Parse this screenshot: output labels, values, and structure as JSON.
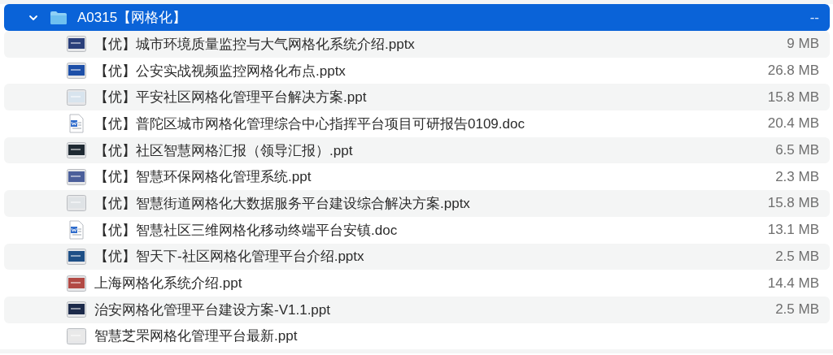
{
  "folder": {
    "name": "A0315【网格化】",
    "size": "--",
    "expanded": true,
    "selected": true
  },
  "files": [
    {
      "name": "【优】城市环境质量监控与大气网格化系统介绍.pptx",
      "size": "9 MB",
      "kind": "slide",
      "color": "#2a3f7a"
    },
    {
      "name": "【优】公安实战视频监控网格化布点.pptx",
      "size": "26.8 MB",
      "kind": "slide",
      "color": "#1d4fa8"
    },
    {
      "name": "【优】平安社区网格化管理平台解决方案.ppt",
      "size": "15.8 MB",
      "kind": "slide",
      "color": "#d8e4ee"
    },
    {
      "name": "【优】普陀区城市网格化管理综合中心指挥平台项目可研报告0109.doc",
      "size": "20.4 MB",
      "kind": "word"
    },
    {
      "name": "【优】社区智慧网格汇报（领导汇报）.ppt",
      "size": "6.5 MB",
      "kind": "slide",
      "color": "#1f2a33"
    },
    {
      "name": "【优】智慧环保网格化管理系统.ppt",
      "size": "2.3 MB",
      "kind": "slide",
      "color": "#4b5f9a"
    },
    {
      "name": "【优】智慧街道网格化大数据服务平台建设综合解决方案.pptx",
      "size": "15.8 MB",
      "kind": "slide",
      "color": "#dfe3e6"
    },
    {
      "name": "【优】智慧社区三维网格化移动终端平台安镇.doc",
      "size": "13.1 MB",
      "kind": "word"
    },
    {
      "name": "【优】智天下-社区网格化管理平台介绍.pptx",
      "size": "2.5 MB",
      "kind": "slide",
      "color": "#1e4f86"
    },
    {
      "name": "上海网格化系统介绍.ppt",
      "size": "14.4 MB",
      "kind": "slide",
      "color": "#b24a45"
    },
    {
      "name": "治安网格化管理平台建设方案-V1.1.ppt",
      "size": "2.5 MB",
      "kind": "slide",
      "color": "#1c2a4a"
    },
    {
      "name": "智慧芝罘网格化管理平台最新.ppt",
      "kind": "slide",
      "color": "#e9e9e9"
    }
  ]
}
